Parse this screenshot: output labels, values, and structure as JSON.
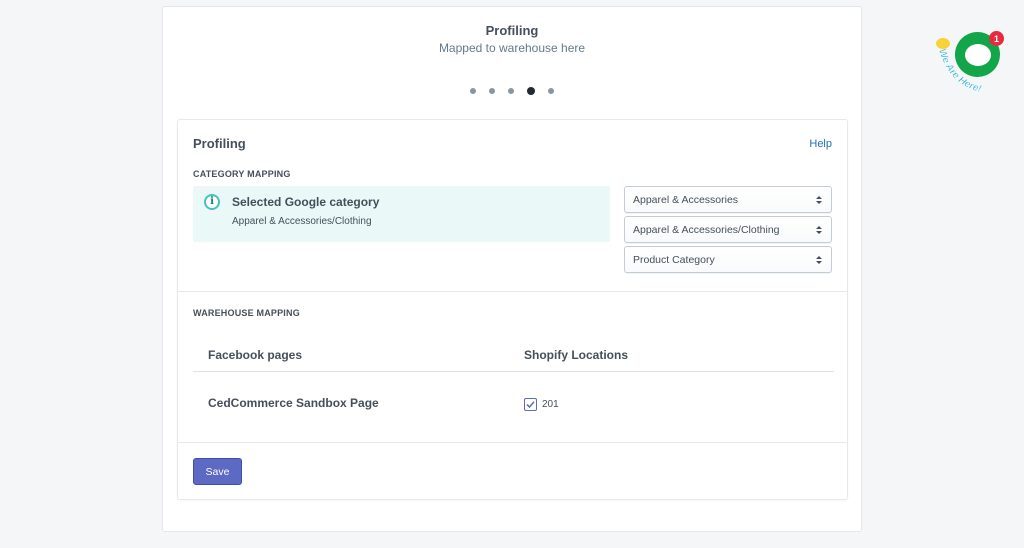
{
  "header": {
    "title": "Profiling",
    "subtitle": "Mapped to warehouse here",
    "steps": {
      "total": 5,
      "current": 4
    }
  },
  "card": {
    "title": "Profiling",
    "help_label": "Help",
    "category_section_label": "CATEGORY MAPPING",
    "banner": {
      "icon": "info-icon",
      "title": "Selected Google category",
      "text": "Apparel & Accessories/Clothing"
    },
    "selects": [
      {
        "value": "Apparel & Accessories"
      },
      {
        "value": "Apparel & Accessories/Clothing"
      },
      {
        "value": "Product Category"
      }
    ],
    "warehouse_section_label": "WAREHOUSE MAPPING",
    "table": {
      "columns": [
        "Facebook pages",
        "Shopify Locations"
      ],
      "rows": [
        {
          "page": "CedCommerce Sandbox Page",
          "location": "201",
          "checked": true
        }
      ]
    },
    "save_label": "Save"
  },
  "chat_widget": {
    "badge_count": "1",
    "tagline": "We Are Here!"
  },
  "colors": {
    "accent": "#5c6ac4",
    "link": "#1f6fb5",
    "banner_bg": "#eaf8f7",
    "chat_green": "#13a54a",
    "badge_red": "#e8293e"
  }
}
